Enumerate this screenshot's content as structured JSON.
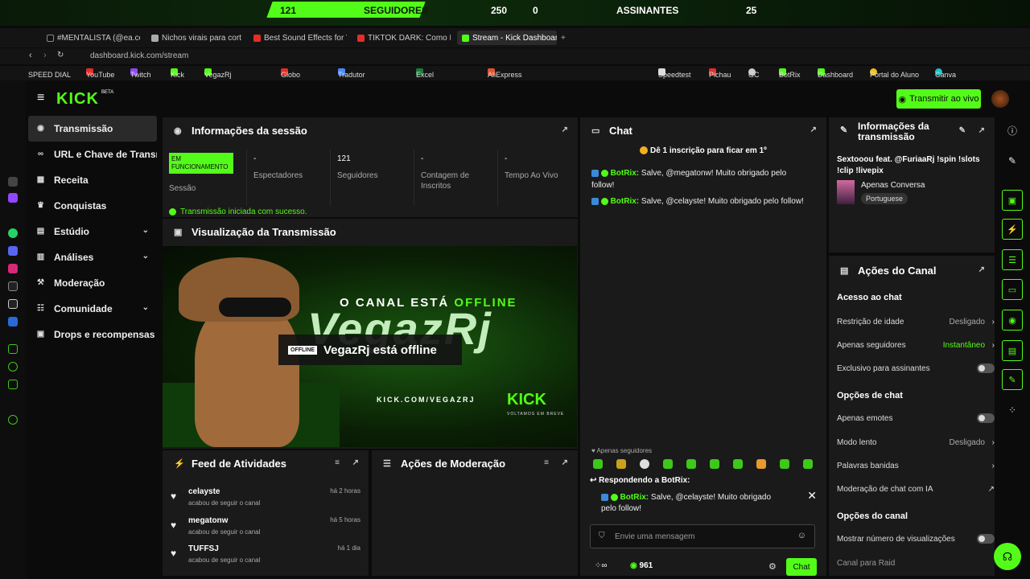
{
  "banner": {
    "followers_label": "SEGUIDORES",
    "followers_current": "121",
    "followers_goal": "250",
    "subs_label": "ASSINANTES",
    "subs_current": "0",
    "subs_goal": "25",
    "followers_progress": 0.484
  },
  "browser": {
    "tabs": [
      "#MENTALISTA (@ea.codig",
      "Nichos virais para cortes",
      "Best Sound Effects for Vid",
      "TIKTOK DARK: Como MON",
      "Stream - Kick Dashboard"
    ],
    "url": "dashboard.kick.com/stream",
    "bookmarks": [
      "SPEED DIAL",
      "YouTube",
      "Twitch",
      "Kick",
      "VegazRj",
      "Globo",
      "Tradutor",
      "Excel",
      "AliExpress",
      "Speedtest",
      "Pichau",
      "GC",
      "BotRix",
      "Dashboard",
      "Portal do Aluno",
      "Canva"
    ]
  },
  "header": {
    "logo": "KICK",
    "beta": "BETA",
    "go_live": "Transmitir ao vivo"
  },
  "nav": [
    {
      "label": "Transmissão"
    },
    {
      "label": "URL e Chave de Transmissão"
    },
    {
      "label": "Receita"
    },
    {
      "label": "Conquistas"
    },
    {
      "label": "Estúdio"
    },
    {
      "label": "Análises"
    },
    {
      "label": "Moderação"
    },
    {
      "label": "Comunidade"
    },
    {
      "label": "Drops e recompensas"
    }
  ],
  "session": {
    "title": "Informações da sessão",
    "status_badge": "EM FUNCIONAMENTO",
    "status_label": "Sessão",
    "stats": [
      {
        "value": "-",
        "label": "Espectadores"
      },
      {
        "value": "121",
        "label": "Seguidores"
      },
      {
        "value": "-",
        "label": "Contagem de Inscritos"
      },
      {
        "value": "-",
        "label": "Tempo Ao Vivo"
      }
    ],
    "success": "Transmissão iniciada com sucesso."
  },
  "preview": {
    "title": "Visualização da Transmissão",
    "offline_pre": "O CANAL ESTÁ ",
    "offline_word": "OFFLINE",
    "brand": "VegazRj",
    "badge": "OFFLINE",
    "offline_msg": "VegazRj está offline",
    "channel_url": "KICK.COM/VEGAZRJ",
    "kick": "KICK",
    "back_soon": "VOLTAMOS EM BREVE"
  },
  "feed": {
    "title": "Feed de Atividades",
    "items": [
      {
        "name": "celayste",
        "desc": "acabou de seguir o canal",
        "time": "há 2 horas"
      },
      {
        "name": "megatonw",
        "desc": "acabou de seguir o canal",
        "time": "há 5 horas"
      },
      {
        "name": "TUFFSJ",
        "desc": "acabou de seguir o canal",
        "time": "há 1 dia"
      }
    ]
  },
  "moderation": {
    "title": "Ações de Moderação"
  },
  "chat": {
    "title": "Chat",
    "promo": "Dê 1 inscrição para ficar em 1º",
    "messages": [
      {
        "user": "BotRix:",
        "text": "Salve, @megatonw! Muito obrigado pelo follow!"
      },
      {
        "user": "BotRix:",
        "text": "Salve, @celayste! Muito obrigado pelo follow!"
      }
    ],
    "followers_only": "Apenas seguidores",
    "replying": "Respondendo a BotRix:",
    "reply_user": "BotRix:",
    "reply_text": "Salve, @celayste! Muito obrigado pelo follow!",
    "placeholder": "Envie uma mensagem",
    "points": "961",
    "send": "Chat"
  },
  "stream_info": {
    "title": "Informações da transmissão",
    "stream_title": "Sextooou feat. @FuriaaRj !spin !slots !clip !livepix",
    "category": "Apenas Conversa",
    "language": "Portuguese"
  },
  "channel_actions": {
    "title": "Ações do Canal",
    "chat_access": "Acesso ao chat",
    "age": {
      "label": "Restrição de idade",
      "value": "Desligado"
    },
    "followers_only": {
      "label": "Apenas seguidores",
      "value": "Instantâneo"
    },
    "subs_only": "Exclusivo para assinantes",
    "chat_options": "Opções de chat",
    "emotes_only": "Apenas emotes",
    "slow": {
      "label": "Modo lento",
      "value": "Desligado"
    },
    "banned": "Palavras banidas",
    "ai_mod": "Moderação de chat com IA",
    "channel_options": "Opções do canal",
    "show_views": "Mostrar número de visualizações",
    "raid": "Canal para Raid"
  }
}
